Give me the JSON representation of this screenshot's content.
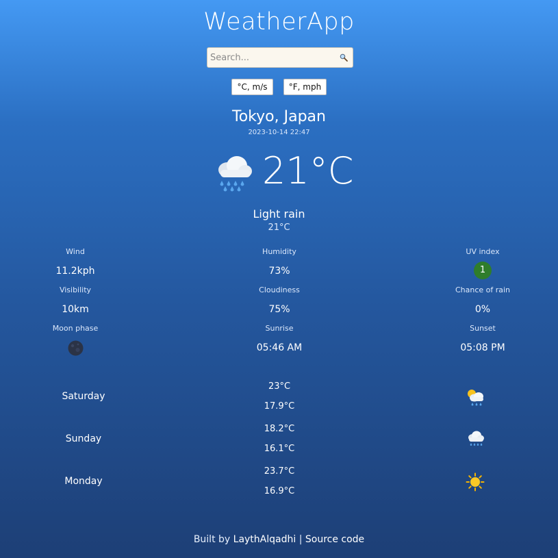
{
  "app": {
    "title": "WeatherApp"
  },
  "search": {
    "placeholder": "Search..."
  },
  "units": {
    "metric_label": "°C, m/s",
    "imperial_label": "°F, mph"
  },
  "location": {
    "name": "Tokyo, Japan",
    "localtime": "2023-10-14 22:47"
  },
  "current": {
    "icon": "cloud-rain-icon",
    "temp": "21°C",
    "condition": "Light rain",
    "feels_like": "21°C"
  },
  "stats": {
    "wind": {
      "label": "Wind",
      "value": "11.2kph"
    },
    "humidity": {
      "label": "Humidity",
      "value": "73%"
    },
    "uv": {
      "label": "UV index",
      "value": "1",
      "color": "#2f7d2b"
    },
    "visibility": {
      "label": "Visibility",
      "value": "10km"
    },
    "cloudiness": {
      "label": "Cloudiness",
      "value": "75%"
    },
    "rain_chance": {
      "label": "Chance of rain",
      "value": "0%"
    },
    "moon": {
      "label": "Moon phase",
      "icon": "new-moon-icon"
    },
    "sunrise": {
      "label": "Sunrise",
      "value": "05:46 AM"
    },
    "sunset": {
      "label": "Sunset",
      "value": "05:08 PM"
    }
  },
  "forecast": [
    {
      "day": "Saturday",
      "high": "23°C",
      "low": "17.9°C",
      "icon": "sun-cloud-rain-icon"
    },
    {
      "day": "Sunday",
      "high": "18.2°C",
      "low": "16.1°C",
      "icon": "cloud-rain-icon"
    },
    {
      "day": "Monday",
      "high": "23.7°C",
      "low": "16.9°C",
      "icon": "sun-icon"
    }
  ],
  "footer": {
    "built_by": "Built by",
    "author": "LaythAlqadhi",
    "separator": "|",
    "source": "Source code"
  },
  "colors": {
    "gradient_top": "#4499f3",
    "gradient_bottom": "#1d3f76",
    "search_bg": "#fbf7ee"
  }
}
